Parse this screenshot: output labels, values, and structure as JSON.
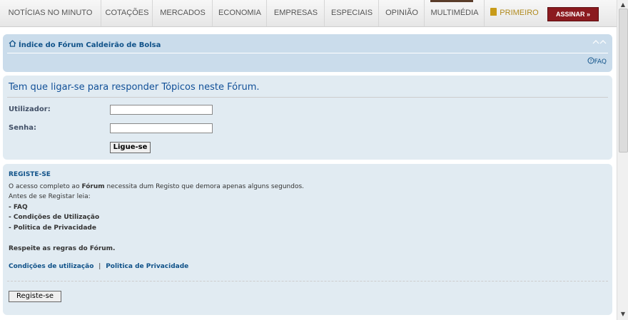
{
  "nav": {
    "items": [
      "NOTÍCIAS NO MINUTO",
      "COTAÇÕES",
      "MERCADOS",
      "ECONOMIA",
      "EMPRESAS",
      "ESPECIAIS",
      "OPINIÃO",
      "MULTIMÉDIA"
    ],
    "premium_label": "PRIMEIRO",
    "subscribe_label": "ASSINAR",
    "subscribe_arrows": "»"
  },
  "breadcrumb": {
    "title": "Índice do Fórum Caldeirão de Bolsa",
    "faq": "FAQ"
  },
  "login": {
    "heading": "Tem que ligar-se para responder Tópicos neste Fórum.",
    "username_label": "Utilizador:",
    "password_label": "Senha:",
    "username_value": "",
    "password_value": "",
    "submit_label": "Ligue-se"
  },
  "register": {
    "title": "REGISTE-SE",
    "line1_pre": "O acesso completo ao ",
    "line1_bold": "Fórum",
    "line1_post": " necessita dum Registo que demora apenas alguns segundos.",
    "line2": "Antes de se Registar leia:",
    "items": [
      "- FAQ",
      "- Condições de Utilização",
      "- Politica de Privacidade"
    ],
    "respect": "Respeite as regras do Fórum.",
    "link_terms": "Condições de utilização",
    "link_separator": "|",
    "link_privacy": "Politica de Privacidade",
    "button_label": "Registe-se"
  },
  "colors": {
    "accent": "#105289",
    "panel": "#e1ebf2",
    "breadcrumb_panel": "#cadceb",
    "subscribe_bg": "#8b1a1f"
  }
}
